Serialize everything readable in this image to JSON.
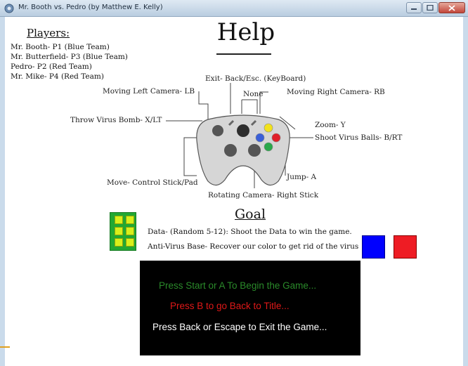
{
  "window": {
    "title": "Mr. Booth vs. Pedro (by Matthew E. Kelly)",
    "controls": [
      "minimize-icon",
      "maximize-icon",
      "close-icon"
    ]
  },
  "players": {
    "heading": "Players:",
    "list": [
      "Mr. Booth- P1 (Blue Team)",
      "Mr. Butterfield- P3 (Blue Team)",
      "Pedro- P2 (Red Team)",
      "Mr. Mike- P4 (Red Team)"
    ]
  },
  "help": {
    "title": "Help"
  },
  "controller": {
    "labels": {
      "exit": "Exit- Back/Esc. (KeyBoard)",
      "moving_left": "Moving  Left  Camera- LB",
      "none": "None",
      "moving_right": "Moving Right Camera- RB",
      "throw_virus": "Throw Virus Bomb- X/LT",
      "zoom": "Zoom- Y",
      "shoot_virus": "Shoot Virus Balls- B/RT",
      "jump": "Jump- A",
      "move": "Move- Control Stick/Pad",
      "rotating": "Rotating Camera- Right Stick"
    },
    "button_colors": {
      "yellow_y": "#f2e21c",
      "red_b": "#e0202a",
      "blue_x": "#3a5fd8",
      "green_a": "#2aa84a"
    }
  },
  "goal": {
    "title": "Goal",
    "data_line": "Data- (Random 5-12): Shoot the Data to win the game.",
    "antivirus_line": "Anti-Virus Base- Recover our color to get rid of the virus",
    "data_icon": "data-chip-icon",
    "team_colors": {
      "blue": "#0000ff",
      "red": "#ee1c24"
    }
  },
  "menu": {
    "start": "Press Start or A To Begin the Game...",
    "back": "Press B to go Back to Title...",
    "exit": "Press Back or Escape to Exit the Game...",
    "colors": {
      "start": "#2a8a2a",
      "back": "#e01818",
      "exit": "#ffffff"
    }
  }
}
